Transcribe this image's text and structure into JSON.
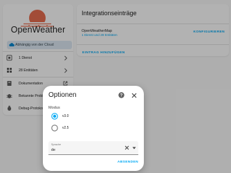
{
  "sidebar": {
    "brand": "OpenWeather",
    "cloud_badge": "Abhängig von der Cloud",
    "items": [
      {
        "label": "1 Dienst",
        "icon": "service-icon"
      },
      {
        "label": "28 Entitäten",
        "icon": "entities-icon"
      },
      {
        "label": "Dokumentation",
        "icon": "book-icon"
      },
      {
        "label": "Bekannte Probleme",
        "icon": "bug-icon"
      },
      {
        "label": "Debug-Protokollierung",
        "icon": "debug-icon"
      }
    ]
  },
  "integration": {
    "title": "Integrationseinträge",
    "entry_name": "OpenWeatherMap",
    "entry_sub": "1 Dienst und 28 Entitäten",
    "configure_label": "KONFIGURIEREN",
    "add_entry_label": "EINTRAG HINZUFÜGEN"
  },
  "dialog": {
    "title": "Optionen",
    "mode_label": "Modus",
    "options": [
      {
        "label": "v3.0",
        "selected": true
      },
      {
        "label": "v2.5",
        "selected": false
      }
    ],
    "language_caption": "Sprache",
    "language_value": "de",
    "submit_label": "ABSENDEN"
  },
  "colors": {
    "accent": "#03a9f4",
    "radio_selected": "#03a9f4",
    "logo_red": "#e96e50",
    "cloud_badge_bg": "#dfeaf5"
  }
}
